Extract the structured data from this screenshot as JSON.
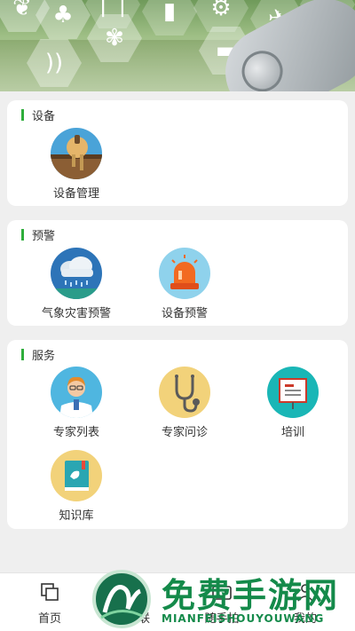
{
  "sections": {
    "device": {
      "title": "设备",
      "items": [
        {
          "label": "设备管理",
          "icon": "soil-sensor-icon"
        }
      ]
    },
    "warning": {
      "title": "预警",
      "items": [
        {
          "label": "气象灾害预警",
          "icon": "rain-cloud-icon"
        },
        {
          "label": "设备预警",
          "icon": "alarm-light-icon"
        }
      ]
    },
    "service": {
      "title": "服务",
      "items": [
        {
          "label": "专家列表",
          "icon": "doctor-icon"
        },
        {
          "label": "专家问诊",
          "icon": "stethoscope-icon"
        },
        {
          "label": "培训",
          "icon": "presentation-board-icon"
        },
        {
          "label": "知识库",
          "icon": "book-icon"
        }
      ]
    }
  },
  "tabbar": [
    {
      "label": "首页",
      "icon": "home-squares-icon"
    },
    {
      "label": "互联",
      "icon": "connect-icon"
    },
    {
      "label": "随手拍",
      "icon": "camera-icon"
    },
    {
      "label": "我的",
      "icon": "user-icon"
    }
  ],
  "watermark": {
    "title": "免费手游网",
    "subtitle": "MIANFEISHOUYOUWANG"
  },
  "colors": {
    "accent": "#2fae3c",
    "watermark": "#148a4a"
  }
}
